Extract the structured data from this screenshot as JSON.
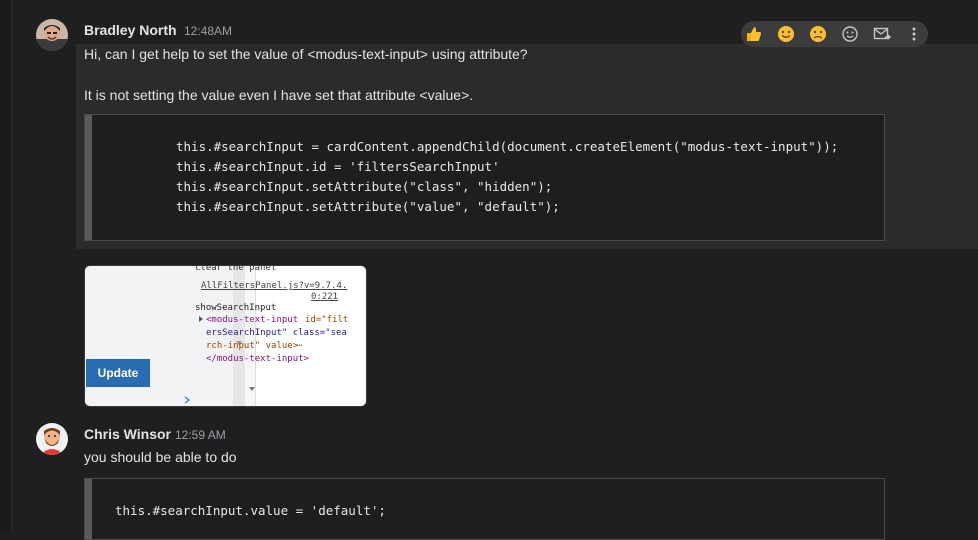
{
  "colors": {
    "background": "#1f1f1f",
    "hover": "#2b2b2b",
    "update_button": "#2b6cb0",
    "tag_color": "#881280",
    "attr_name": "#994500",
    "attr_value": "#1a1aa6"
  },
  "toolbar": {
    "icons": [
      "thumbs-up-icon",
      "smile-icon",
      "frown-icon",
      "add-reaction-icon",
      "forward-email-icon",
      "more-vert-icon"
    ]
  },
  "messages": [
    {
      "author": "Bradley North",
      "time": "12:48AM",
      "lines": [
        "Hi, can I get help to set the value of <modus-text-input> using attribute?",
        "It is not setting the value even I have set that attribute <value>."
      ],
      "code": [
        "this.#searchInput = cardContent.appendChild(document.createElement(\"modus-text-input\"));",
        "this.#searchInput.id = 'filtersSearchInput'",
        "this.#searchInput.setAttribute(\"class\", \"hidden\");",
        "this.#searchInput.setAttribute(\"value\", \"default\");"
      ],
      "attachment": {
        "button_label": "Update",
        "texts": {
          "clear": "clear the panel",
          "link1": "AllFiltersPanel.js?v=9.7.4.",
          "link2": "0:221",
          "label": "showSearchInput",
          "tag_open": "<modus-text-input",
          "attr1": "id=\"filt",
          "line2": "ersSearchInput\" class=\"sea",
          "line3": "rch-input\" value>",
          "ellipsis": "⋯",
          "tag_close": "</modus-text-input>"
        }
      }
    },
    {
      "author": "Chris Winsor",
      "time": "12:59 AM",
      "lines": [
        "you should be able to do"
      ],
      "code": [
        "this.#searchInput.value = 'default';"
      ]
    }
  ]
}
